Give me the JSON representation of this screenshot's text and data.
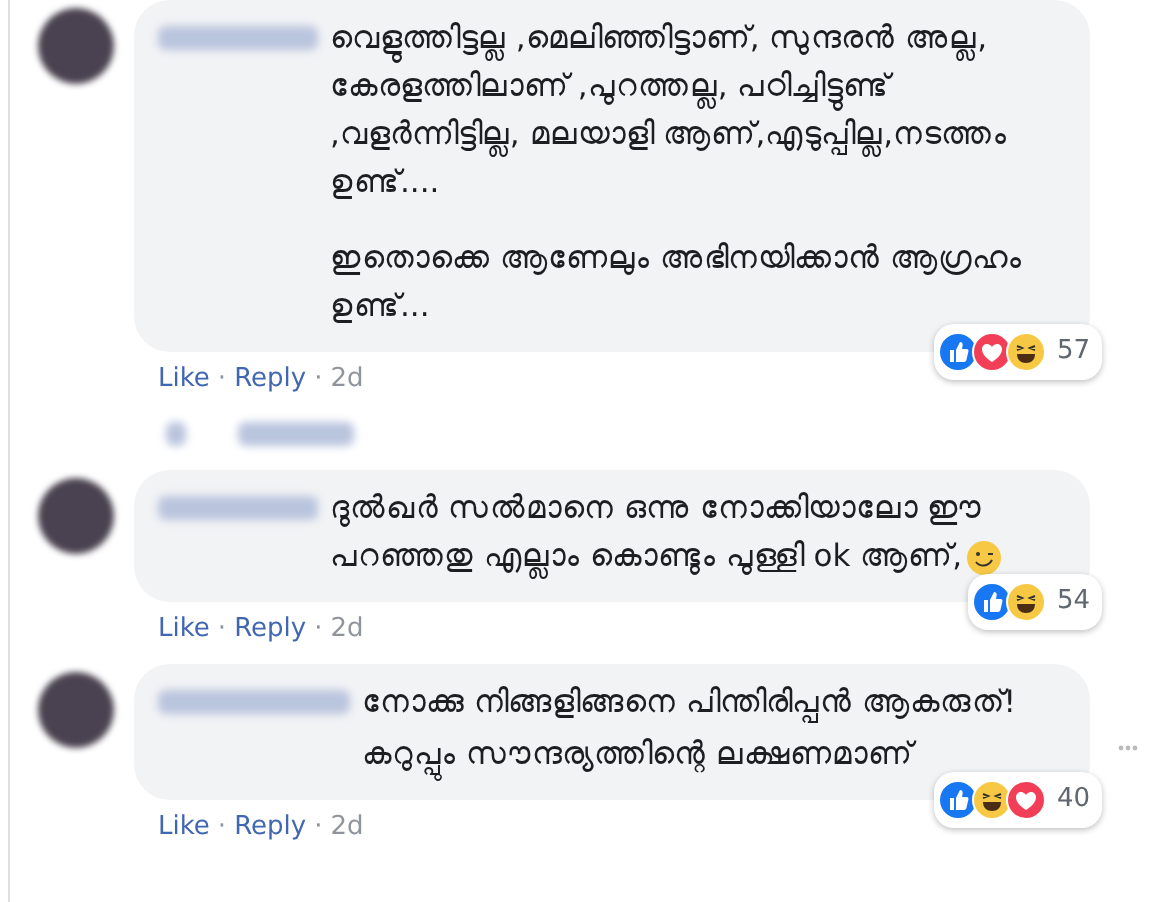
{
  "comments": [
    {
      "paragraphs": [
        "വെളുത്തിട്ടല്ല ,മെലിഞ്ഞിട്ടാണ്, സുന്ദരൻ അല്ല, കേരളത്തിലാണ് ,പുറത്തല്ല, പഠിച്ചിട്ടുണ്ട് ,വളർന്നിട്ടില്ല, മലയാളി ആണ്,എടുപ്പില്ല,നടത്തം ഉണ്ട്....",
        "ഇതൊക്കെ ആണേലും അഭിനയിക്കാൻ ആഗ്രഹം ഉണ്ട്..."
      ],
      "emoji": false,
      "reactions": [
        {
          "kind": "like"
        },
        {
          "kind": "love"
        },
        {
          "kind": "haha"
        }
      ],
      "count": "57",
      "actions": [
        "Like",
        "Reply",
        "2d"
      ],
      "separator": "·",
      "replies_blurred": true,
      "menu": false
    },
    {
      "paragraphs": [
        "ദുൽഖർ സൽമാനെ ഒന്നു നോക്കിയാലോ ഈ പറഞ്ഞതു എല്ലാം കൊണ്ടും പുള്ളി ok ആണ്,"
      ],
      "emoji": true,
      "reactions": [
        {
          "kind": "like"
        },
        {
          "kind": "haha"
        }
      ],
      "count": "54",
      "actions": [
        "Like",
        "Reply",
        "2d"
      ],
      "separator": "·",
      "replies_blurred": false,
      "menu": false
    },
    {
      "paragraphs": [
        "നോക്കു നിങ്ങളിങ്ങനെ പിന്തിരിപ്പൻ ആകരുത്!",
        "കറുപ്പും സൗന്ദര്യത്തിന്റെ ലക്ഷണമാണ്"
      ],
      "emoji": false,
      "reactions": [
        {
          "kind": "like"
        },
        {
          "kind": "haha"
        },
        {
          "kind": "love"
        }
      ],
      "count": "40",
      "actions": [
        "Like",
        "Reply",
        "2d"
      ],
      "separator": "·",
      "replies_blurred": false,
      "menu": true
    }
  ]
}
